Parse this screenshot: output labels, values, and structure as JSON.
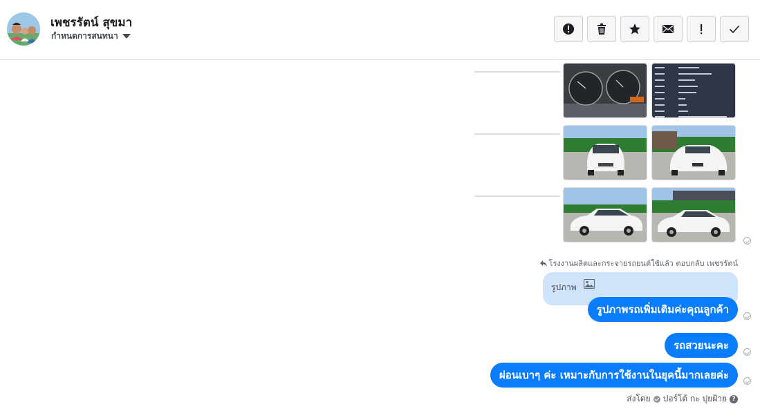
{
  "header": {
    "user_name": "เพชรรัตน์ สุขมา",
    "assign_label": "กำหนดการสนทนา"
  },
  "toolbar": [
    {
      "name": "report-spam-button",
      "icon": "alert-circle-icon"
    },
    {
      "name": "delete-button",
      "icon": "trash-icon"
    },
    {
      "name": "star-button",
      "icon": "star-icon"
    },
    {
      "name": "mark-unread-button",
      "icon": "envelope-icon"
    },
    {
      "name": "mark-important-button",
      "icon": "exclamation-icon"
    },
    {
      "name": "mark-done-button",
      "icon": "check-icon"
    }
  ],
  "photos": [
    {
      "name": "photo-dashboard",
      "alt": "odometer dashboard"
    },
    {
      "name": "photo-spec-card",
      "alt": "vehicle spec card"
    },
    {
      "name": "photo-car-front",
      "alt": "white sedan front view"
    },
    {
      "name": "photo-car-rear",
      "alt": "white sedan rear view"
    },
    {
      "name": "photo-car-side-1",
      "alt": "white sedan side view"
    },
    {
      "name": "photo-car-side-2",
      "alt": "white sedan side view"
    }
  ],
  "thread": {
    "reply_note": "โรงงานผลิตและกระจายรถยนต์ใช้แล้ว ตอบกลับ เพชรรัตน์",
    "quoted_label": "รูปภาพ",
    "messages": [
      "รูปภาพรถเพิ่มเติมค่ะคุณลูกค้า",
      "รถสวยนะคะ",
      "ผ่อนเบาๆ ค่ะ เหมาะกับการใช้งานในยุคนี้มากเลยค่ะ"
    ],
    "sent_by_prefix": "ส่งโดย",
    "sent_by_name": "ปอร์โต้ กะ ปุยฝ้าย"
  },
  "colors": {
    "bubble": "#0a7cff",
    "quoted_bg": "#cfe3fb",
    "border": "#dddfe2"
  }
}
